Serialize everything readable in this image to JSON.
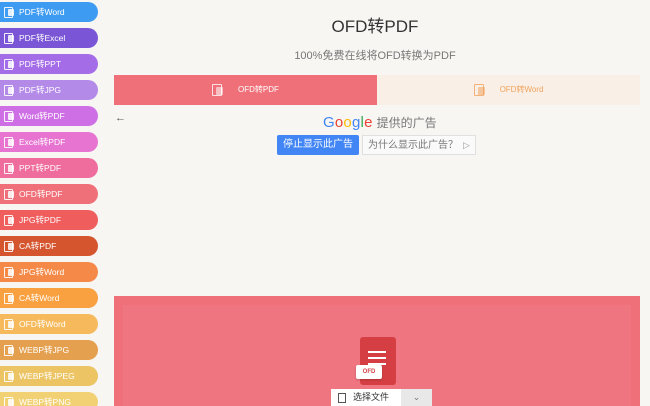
{
  "sidebar": {
    "items": [
      {
        "label": "PDF转Word",
        "color": "#3d9cf2"
      },
      {
        "label": "PDF转Excel",
        "color": "#7a55d6"
      },
      {
        "label": "PDF转PPT",
        "color": "#a46de7"
      },
      {
        "label": "PDF转JPG",
        "color": "#b48ae9"
      },
      {
        "label": "Word转PDF",
        "color": "#cf6fe6"
      },
      {
        "label": "Excel转PDF",
        "color": "#e774d1"
      },
      {
        "label": "PPT转PDF",
        "color": "#ef6d9c"
      },
      {
        "label": "OFD转PDF",
        "color": "#f07079"
      },
      {
        "label": "JPG转PDF",
        "color": "#ef5d5d"
      },
      {
        "label": "CA转PDF",
        "color": "#d5552f"
      },
      {
        "label": "JPG转Word",
        "color": "#f58a48"
      },
      {
        "label": "CA转Word",
        "color": "#f9a040"
      },
      {
        "label": "OFD转Word",
        "color": "#f6ba5d"
      },
      {
        "label": "WEBP转JPG",
        "color": "#e5a04f"
      },
      {
        "label": "WEBP转JPEG",
        "color": "#ecc463"
      },
      {
        "label": "WEBP转PNG",
        "color": "#f2d174"
      }
    ]
  },
  "header": {
    "title": "OFD转PDF",
    "subtitle": "100%免费在线将OFD转换为PDF"
  },
  "tabs": [
    {
      "label": "OFD转PDF",
      "active": true
    },
    {
      "label": "OFD转Word",
      "active": false
    }
  ],
  "ad": {
    "back_icon": "left-arrow-icon",
    "back_glyph": "←",
    "google_letters": [
      {
        "ch": "G",
        "color": "#4285f4"
      },
      {
        "ch": "o",
        "color": "#ea4335"
      },
      {
        "ch": "o",
        "color": "#fbbc05"
      },
      {
        "ch": "g",
        "color": "#4285f4"
      },
      {
        "ch": "l",
        "color": "#34a853"
      },
      {
        "ch": "e",
        "color": "#ea4335"
      }
    ],
    "provided_text": "提供的广告",
    "stop_button": "停止显示此广告",
    "why_button": "为什么显示此广告？",
    "why_icon_glyph": "▷"
  },
  "upload": {
    "file_badge": "OFD",
    "choose_label": "选择文件",
    "dropdown_glyph": "⌄"
  },
  "colors": {
    "accent": "#f07079",
    "ofd_word_tab_text": "#f2a35c"
  }
}
